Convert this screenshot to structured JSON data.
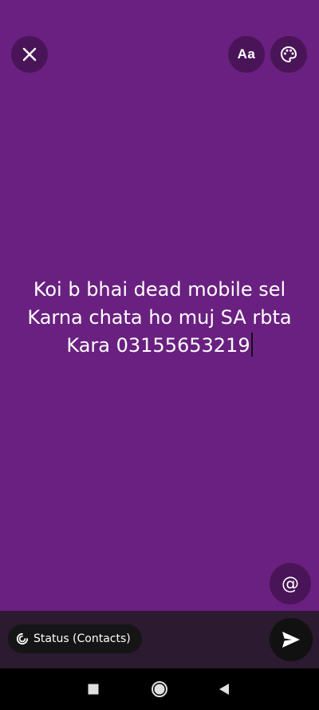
{
  "status_text": {
    "lines": [
      "Koi b bhai dead mobile sel",
      "Karna chata ho muj SA rbta",
      "Kara 03155653219"
    ]
  },
  "toolbar": {
    "font_label": "Aa",
    "close_icon": "close-icon",
    "palette_icon": "palette-icon"
  },
  "mention": {
    "label": "@"
  },
  "bottom_bar": {
    "audience_label": "Status (Contacts)",
    "audience_icon": "status-ring-icon",
    "send_icon": "send-icon"
  },
  "colors": {
    "background": "#6a2080",
    "button_bg": "#4a1558",
    "bottom_bar": "#2b1a30"
  }
}
